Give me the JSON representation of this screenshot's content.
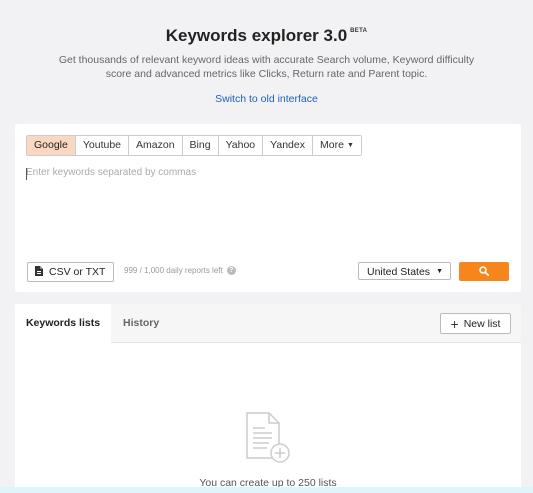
{
  "header": {
    "title": "Keywords explorer 3.0",
    "beta_badge": "BETA",
    "subtitle": "Get thousands of relevant keyword ideas with accurate Search volume, Keyword difficulty score and advanced metrics like Clicks, Return rate and Parent topic.",
    "switch_link": "Switch to old interface"
  },
  "search": {
    "engines": [
      {
        "label": "Google",
        "active": true
      },
      {
        "label": "Youtube",
        "active": false
      },
      {
        "label": "Amazon",
        "active": false
      },
      {
        "label": "Bing",
        "active": false
      },
      {
        "label": "Yahoo",
        "active": false
      },
      {
        "label": "Yandex",
        "active": false
      },
      {
        "label": "More",
        "active": false
      }
    ],
    "placeholder": "Enter keywords separated by commas",
    "csv_label": "CSV or TXT",
    "reports_left": "999 / 1,000 daily reports left",
    "help_icon": "question-circle-icon",
    "country": "United States",
    "search_icon": "search-icon"
  },
  "lists": {
    "tabs": [
      {
        "label": "Keywords lists",
        "active": true
      },
      {
        "label": "History",
        "active": false
      }
    ],
    "new_list_label": "New list",
    "empty_icon": "document-add-icon",
    "empty_text": "You can create up to 250 lists"
  },
  "colors": {
    "accent": "#f7851e",
    "active_tab": "#fcd7bf",
    "link": "#1c62b9",
    "background": "#f2f2f4"
  }
}
